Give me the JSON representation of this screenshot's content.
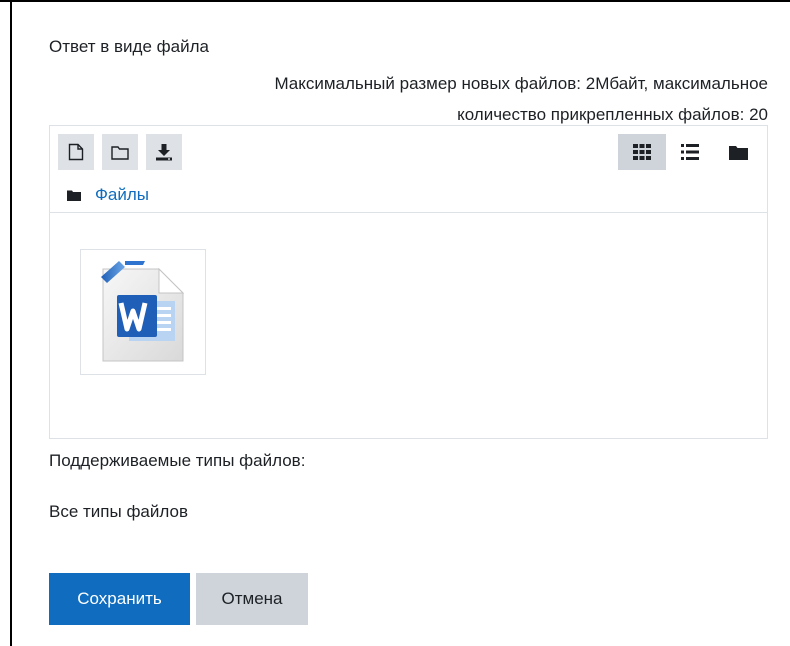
{
  "form": {
    "field_label": "Ответ в виде файла",
    "limits_line1": "Максимальный размер новых файлов: 2Мбайт, максимальное",
    "limits_line2": "количество прикрепленных файлов: 20"
  },
  "filemanager": {
    "toolbar": {
      "icons": [
        "new-file-icon",
        "create-folder-icon",
        "download-icon",
        "view-icons-icon",
        "view-list-icon",
        "view-tree-icon"
      ],
      "active_view": "icons"
    },
    "path": {
      "folder_label": "Файлы"
    },
    "files": [
      {
        "icon": "word-document-icon"
      }
    ]
  },
  "supported_types": {
    "label": "Поддерживаемые типы файлов:",
    "value": "Все типы файлов"
  },
  "actions": {
    "save_label": "Сохранить",
    "cancel_label": "Отмена"
  },
  "colors": {
    "primary": "#0f6cbf",
    "secondary": "#ced4da",
    "border": "#dee2e6",
    "text": "#1d2125"
  }
}
